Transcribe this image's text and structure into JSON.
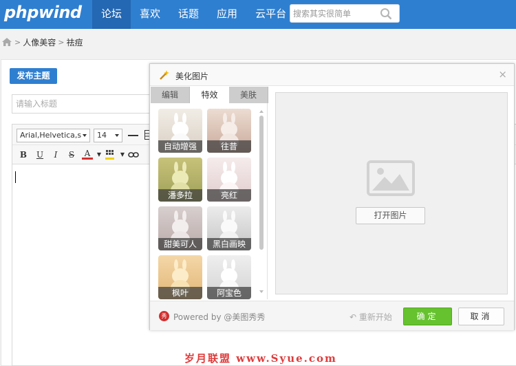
{
  "header": {
    "logo": "phpwind",
    "nav": [
      "论坛",
      "喜欢",
      "话题",
      "应用",
      "云平台"
    ],
    "search_placeholder": "搜索其实很简单"
  },
  "breadcrumb": {
    "items": [
      "人像美容",
      "祛痘"
    ]
  },
  "editor": {
    "post_button": "发布主题",
    "title_placeholder": "请输入标题",
    "font_family": "Arial,Helvetica,s",
    "font_size": "14"
  },
  "dialog": {
    "title": "美化图片",
    "tabs": [
      "编辑",
      "特效",
      "美肤"
    ],
    "active_tab": "特效",
    "effects": [
      "自动增强",
      "往昔",
      "潘多拉",
      "亮红",
      "甜美可人",
      "黑白画映",
      "枫叶",
      "阿宝色"
    ],
    "open_image": "打开图片",
    "powered_by": "Powered by @美图秀秀",
    "reset": "重新开始",
    "ok": "确定",
    "cancel": "取消",
    "accent_green": "#66c22f"
  },
  "watermark": "岁月联盟 www.Syue.com",
  "colors": {
    "brand_blue": "#2f7fd0"
  }
}
